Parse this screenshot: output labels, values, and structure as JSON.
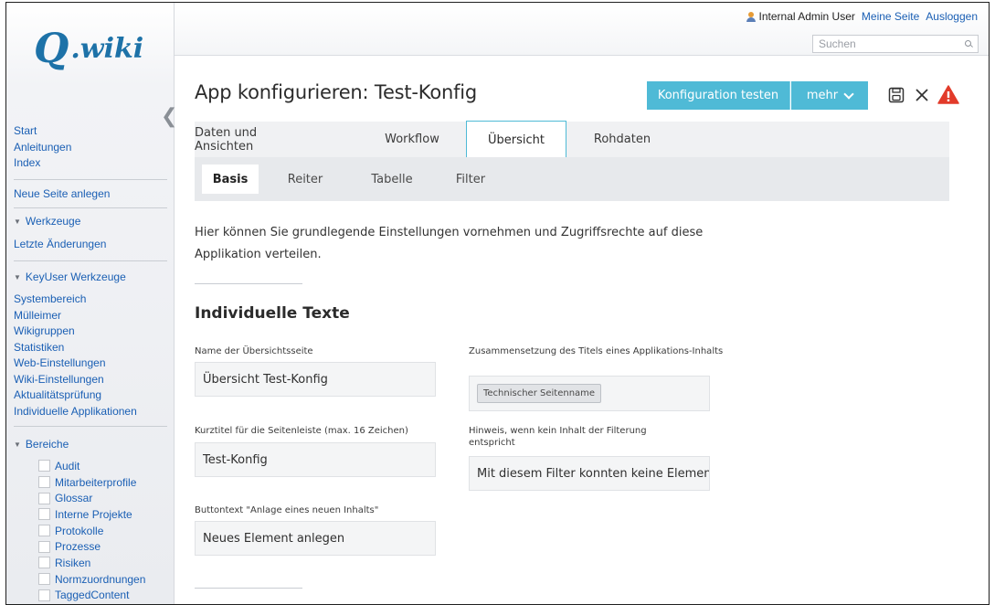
{
  "header": {
    "user_name": "Internal Admin User",
    "my_page": "Meine Seite",
    "logout": "Ausloggen",
    "search_placeholder": "Suchen"
  },
  "logo": {
    "q": "Q",
    "rest": ".wiki"
  },
  "sidebar": {
    "links": [
      "Start",
      "Anleitungen",
      "Index"
    ],
    "new_page": "Neue Seite anlegen",
    "tools": {
      "title": "Werkzeuge",
      "items": [
        "Letzte Änderungen"
      ]
    },
    "keyuser": {
      "title": "KeyUser Werkzeuge",
      "items": [
        "Systembereich",
        "Mülleimer",
        "Wikigruppen",
        "Statistiken",
        "Web-Einstellungen",
        "Wiki-Einstellungen",
        "Aktualitätsprüfung",
        "Individuelle Applikationen"
      ]
    },
    "areas": {
      "title": "Bereiche",
      "items": [
        "Audit",
        "Mitarbeiterprofile",
        "Glossar",
        "Interne Projekte",
        "Protokolle",
        "Prozesse",
        "Risiken",
        "Normzuordnungen",
        "TaggedContent"
      ]
    }
  },
  "main": {
    "title": "App konfigurieren: Test-Konfig",
    "test_button": "Konfiguration testen",
    "more_button": "mehr",
    "tabs": [
      "Daten und Ansichten",
      "Workflow",
      "Übersicht",
      "Rohdaten"
    ],
    "subtabs": [
      "Basis",
      "Reiter",
      "Tabelle",
      "Filter"
    ],
    "intro": "Hier können Sie grundlegende Einstellungen vornehmen und Zugriffsrechte auf diese Applikation verteilen.",
    "section_title": "Individuelle Texte",
    "fields": {
      "overview_name": {
        "label": "Name der Übersichtsseite",
        "value": "Übersicht Test-Konfig"
      },
      "short_title": {
        "label": "Kurztitel für die Seitenleiste (max. 16 Zeichen)",
        "value": "Test-Konfig"
      },
      "button_text": {
        "label": "Buttontext \"Anlage eines neuen Inhalts\"",
        "value": "Neues Element anlegen"
      },
      "title_composition": {
        "label": "Zusammensetzung des Titels eines Applikations-Inhalts",
        "tag": "Technischer Seitenname"
      },
      "no_content_hint": {
        "label": "Hinweis, wenn kein Inhalt der Filterung entspricht",
        "value": "Mit diesem Filter konnten keine Elemente"
      }
    }
  },
  "colors": {
    "accent": "#4fbad6",
    "link": "#1a5fb4",
    "warning": "#e23b2a"
  }
}
